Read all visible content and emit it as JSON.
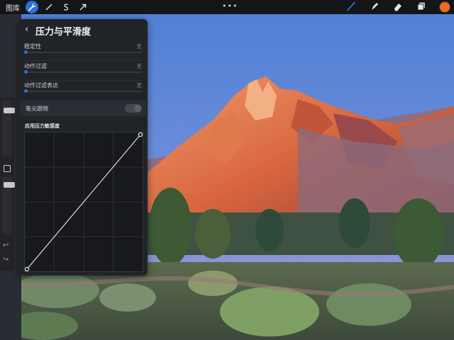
{
  "topbar": {
    "gallery_label": "图库",
    "more_label": "•••",
    "tools_left": [
      {
        "name": "wrench-icon",
        "active": true
      },
      {
        "name": "magic-wand-icon",
        "active": false
      },
      {
        "name": "selection-s-icon",
        "active": false
      },
      {
        "name": "transform-arrow-icon",
        "active": false
      }
    ],
    "tools_right": [
      {
        "name": "brush-icon",
        "color": "#2e6fdc"
      },
      {
        "name": "smudge-icon",
        "color": "#e6e6e6"
      },
      {
        "name": "eraser-icon",
        "color": "#e6e6e6"
      },
      {
        "name": "layers-icon",
        "color": "#e6e6e6"
      }
    ],
    "current_color": "#f26a1b"
  },
  "panel": {
    "title": "压力与平滑度",
    "settings": [
      {
        "label": "稳定性",
        "value": "无",
        "level": 0
      },
      {
        "label": "动作过滤",
        "value": "无",
        "level": 0
      },
      {
        "label": "动作过滤表达",
        "value": "无",
        "level": 0
      }
    ],
    "pencil_tracking": {
      "label": "笔尖跟随",
      "enabled": false
    },
    "pressure_curve": {
      "label": "应用压力敏感度",
      "points": [
        [
          0,
          0
        ],
        [
          1,
          1
        ]
      ]
    }
  },
  "sidebar": {
    "brush_size_level": 0.85,
    "opacity_level": 0.9
  }
}
